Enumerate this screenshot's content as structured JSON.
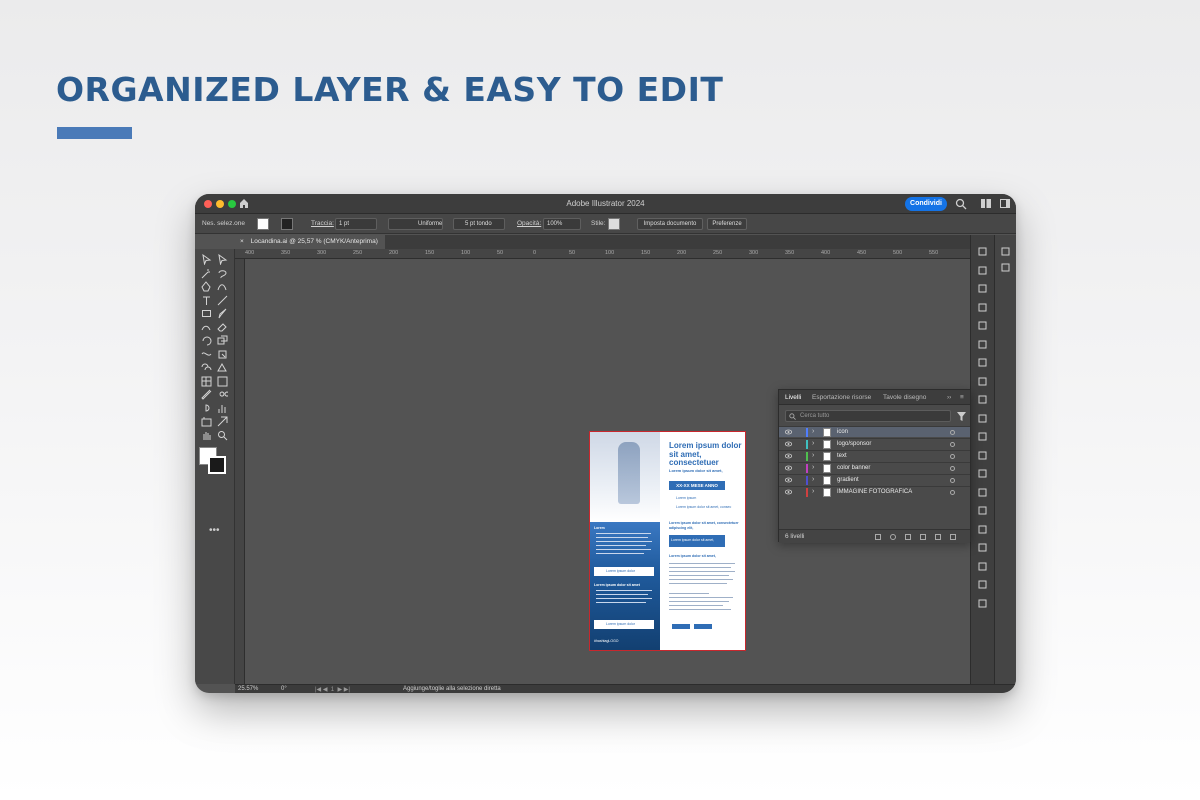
{
  "headline": "ORGANIZED LAYER & EASY TO EDIT",
  "colors": {
    "headline": "#2c5c8f",
    "accent_bar": "#4a7ab8",
    "share": "#1473e6",
    "artboard_blue": "#2f6db5"
  },
  "app": {
    "title": "Adobe Illustrator 2024",
    "share_label": "Condividi"
  },
  "control_bar": {
    "selection_label": "Nes. selez.one",
    "stroke_label": "Traccia:",
    "stroke_value": "1 pt",
    "line_style": "Uniforme",
    "brush": "5 pt tondo",
    "opacity_label": "Opacità:",
    "opacity_value": "100%",
    "style_label": "Stile:",
    "doc_setup": "Imposta documento",
    "preferences": "Preferenze"
  },
  "document_tab": "Locandina.ai @ 25,57 % (CMYK/Anteprima)",
  "ruler_ticks": [
    "400",
    "350",
    "300",
    "250",
    "200",
    "150",
    "100",
    "50",
    "0",
    "50",
    "100",
    "150",
    "200",
    "250",
    "300",
    "350",
    "400",
    "450",
    "500",
    "550"
  ],
  "layers_panel": {
    "tabs": [
      "Livelli",
      "Esportazione risorse",
      "Tavole disegno"
    ],
    "search_placeholder": "Cerca tutto",
    "layers": [
      {
        "name": "icon",
        "color": "#4f7dff",
        "selected": true
      },
      {
        "name": "logo/sponsor",
        "color": "#3fc0c0",
        "selected": false
      },
      {
        "name": "text",
        "color": "#4fc04f",
        "selected": false
      },
      {
        "name": "color banner",
        "color": "#c040c0",
        "selected": false
      },
      {
        "name": "gradient",
        "color": "#4f4fd0",
        "selected": false
      },
      {
        "name": "IMMAGINE FOTOGRAFICA",
        "color": "#d04040",
        "selected": false
      }
    ],
    "count": "6 livelli"
  },
  "artboard": {
    "title": "Lorem ipsum dolor sit amet, consectetuer",
    "subtitle": "Lorem ipsum dolor sit amet,",
    "banner": "XX-XX MESE ANNO",
    "info1": "Lorem ipsum",
    "info2": "Lorem ipsum dolor sit amet, consec",
    "heading2": "Lorem ipsum dolor sit amet, consectetuer adipiscing elit,",
    "box1": "Lorem ipsum dolor sit amet,",
    "heading3": "Lorem ipsum dolor sit amet,",
    "side_title": "Lorem",
    "side_box1": "Lorem ipsum dolor",
    "side_heading": "Lorem ipsum dolor sit amet",
    "side_box2": "Lorem ipsum dolor",
    "side_footer": "#hashtagLOGO"
  },
  "status": {
    "zoom": "25.57%",
    "rotation": "0°",
    "hint": "Aggiunge/toglie alla selezione diretta"
  }
}
